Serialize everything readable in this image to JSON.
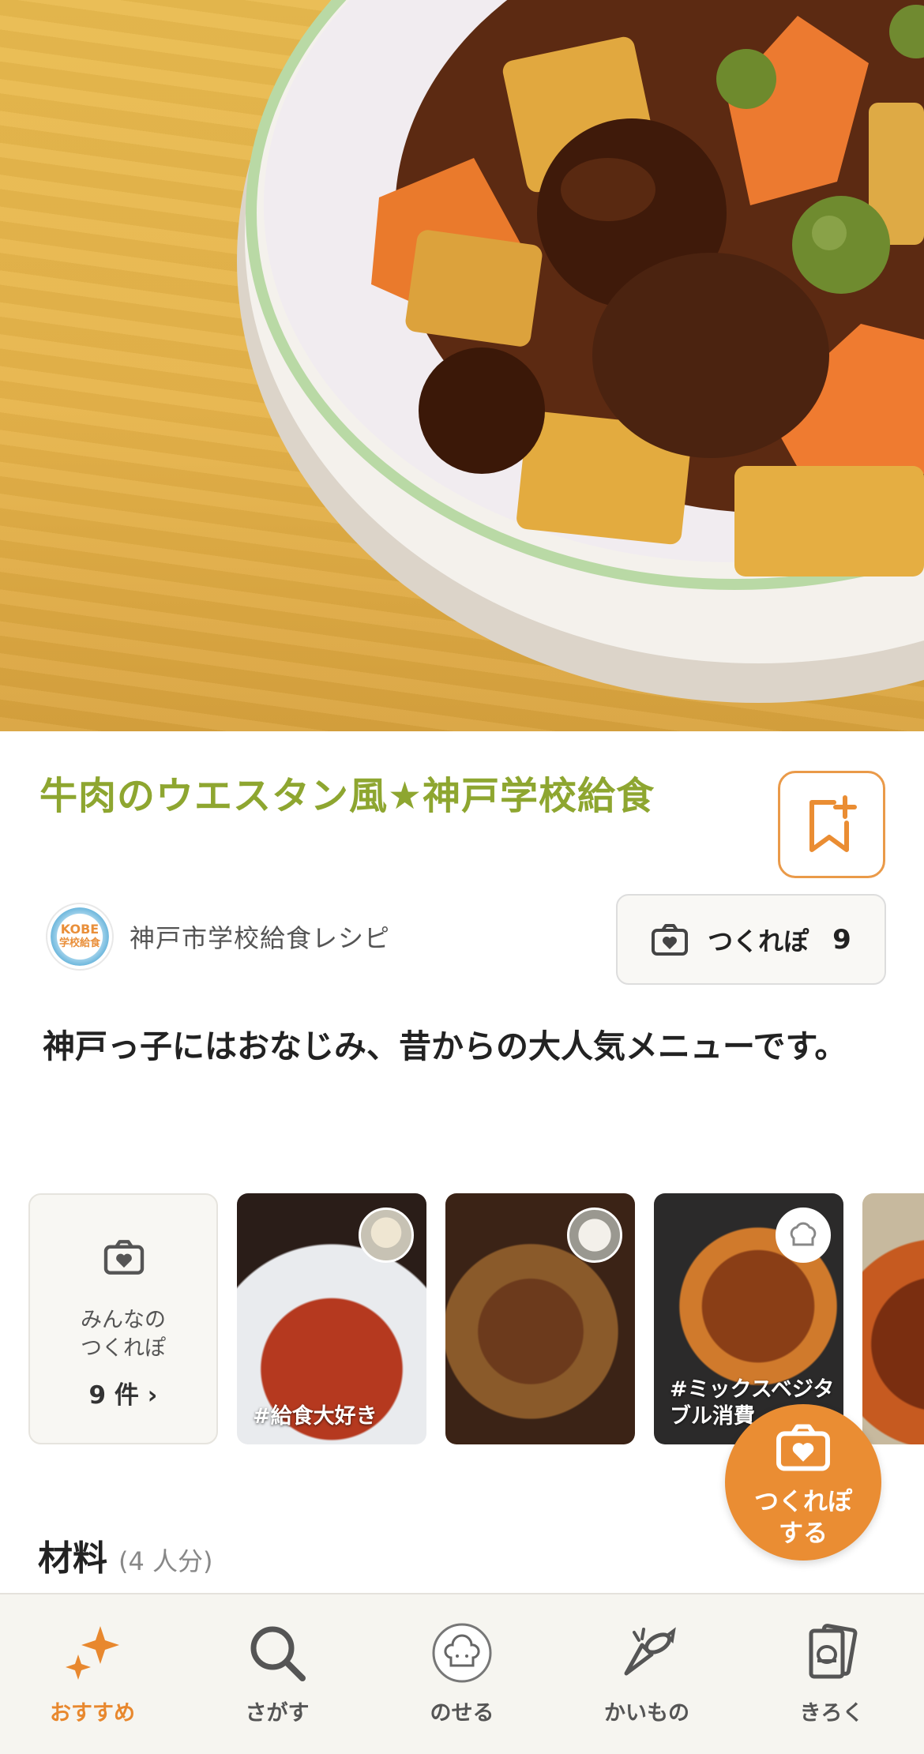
{
  "recipe": {
    "title": "牛肉のウエスタン風★神戸学校給食",
    "author_name": "神戸市学校給食レシピ",
    "author_logo_text_1": "KOBE",
    "author_logo_text_2": "学校給食",
    "description": "神戸っ子にはおなじみ、昔からの大人気メニューです。"
  },
  "tsukurepo_button": {
    "label": "つくれぽ",
    "count": "9"
  },
  "gallery": {
    "summary_line1": "みんなの",
    "summary_line2": "つくれぽ",
    "summary_count": "9 件 ›",
    "items": [
      {
        "tag": "#給食大好き"
      },
      {
        "tag": ""
      },
      {
        "tag": "#ミックスベジタブル消費"
      },
      {
        "tag": ""
      }
    ]
  },
  "fab": {
    "line1": "つくれぽ",
    "line2": "する"
  },
  "ingredients": {
    "heading": "材料",
    "servings": "(4 人分)"
  },
  "tabbar": [
    {
      "label": "おすすめ",
      "icon": "sparkle-icon",
      "active": true
    },
    {
      "label": "さがす",
      "icon": "search-icon",
      "active": false
    },
    {
      "label": "のせる",
      "icon": "chef-hat-icon",
      "active": false
    },
    {
      "label": "かいもの",
      "icon": "groceries-icon",
      "active": false
    },
    {
      "label": "きろく",
      "icon": "recipe-cards-icon",
      "active": false
    }
  ],
  "colors": {
    "accent": "#ea8d33",
    "title_green": "#8ea630"
  }
}
